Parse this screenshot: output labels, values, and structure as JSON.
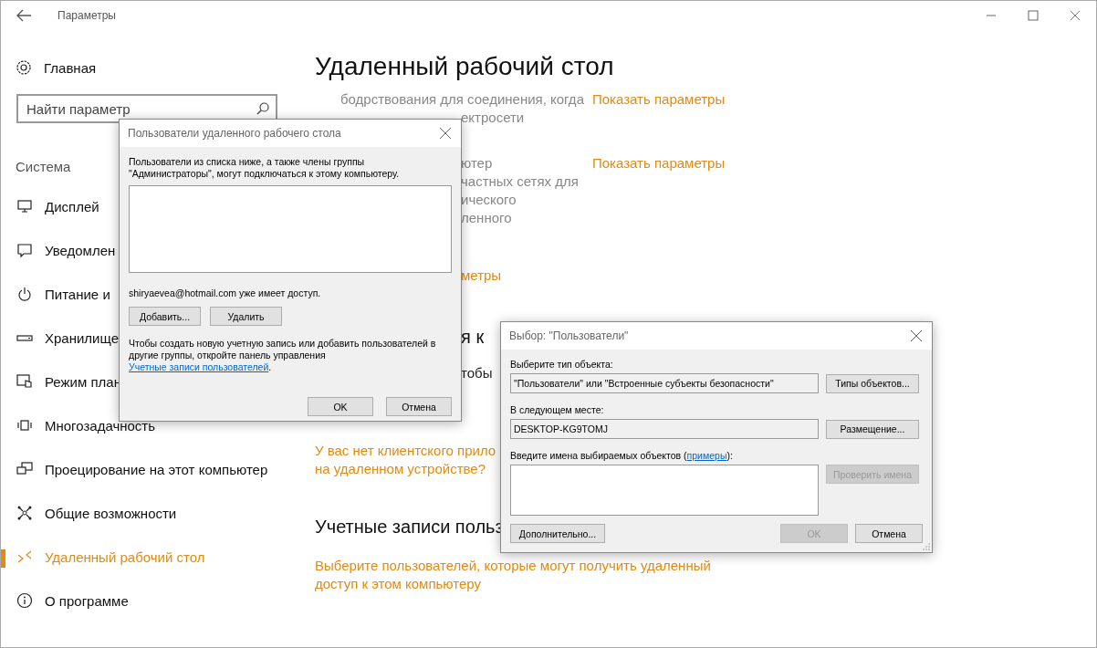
{
  "window": {
    "title": "Параметры"
  },
  "sidebar": {
    "home": "Главная",
    "search": {
      "placeholder": "Найти параметр"
    },
    "section": "Система",
    "items": [
      {
        "label": "Дисплей",
        "kind": "display",
        "selected": false
      },
      {
        "label": "Уведомлен",
        "kind": "notification",
        "selected": false
      },
      {
        "label": "Питание и",
        "kind": "power",
        "selected": false
      },
      {
        "label": "Хранилище",
        "kind": "storage",
        "selected": false
      },
      {
        "label": "Режим план",
        "kind": "tablet",
        "selected": false
      },
      {
        "label": "Многозадачность",
        "kind": "multitask",
        "selected": false
      },
      {
        "label": "Проецирование на этот компьютер",
        "kind": "project",
        "selected": false
      },
      {
        "label": "Общие возможности",
        "kind": "ease",
        "selected": false
      },
      {
        "label": "Удаленный рабочий стол",
        "kind": "remote",
        "selected": true
      },
      {
        "label": "О программе",
        "kind": "info",
        "selected": false
      }
    ]
  },
  "content": {
    "title": "Удаленный рабочий стол",
    "blocks": [
      {
        "kind": "setting",
        "lines": [
          "бодрствования для соединения, когда",
          "ектросети"
        ],
        "link": "Показать параметры"
      },
      {
        "kind": "setting",
        "lines": [
          "ютер",
          "частных сетях для",
          "ического",
          "ленного"
        ],
        "link": "Показать параметры"
      },
      {
        "kind": "link",
        "lines": [
          "метры"
        ]
      },
      {
        "kind": "heading",
        "lines": [
          "я к"
        ]
      },
      {
        "kind": "text",
        "lines": [
          "тобы"
        ]
      },
      {
        "kind": "link",
        "lines": [
          "У вас нет клиентского прило",
          "на удаленном устройстве?"
        ]
      },
      {
        "kind": "heading",
        "lines": [
          "Учетные записи польз"
        ]
      },
      {
        "kind": "link",
        "lines": [
          "Выберите пользователей, которые могут получить удаленный",
          "доступ к этом компьютеру"
        ]
      }
    ]
  },
  "users_dialog": {
    "title": "Пользователи удаленного рабочего стола",
    "intro": "Пользователи из списка ниже, а также члены группы \"Администраторы\", могут подключаться к этому компьютеру.",
    "status": "shiryaevea@hotmail.com уже имеет доступ.",
    "list_buttons": [
      {
        "label": "Добавить...",
        "disabled": false
      },
      {
        "label": "Удалить",
        "disabled": false
      }
    ],
    "help": {
      "text": "Чтобы создать новую учетную запись или добавить пользователей в другие группы, откройте панель управления",
      "link": "Учетные записи пользователей",
      "after": "."
    },
    "buttons": [
      {
        "label": "OK",
        "disabled": false
      },
      {
        "label": "Отмена",
        "disabled": false
      }
    ]
  },
  "select_dialog": {
    "title": "Выбор: \"Пользователи\"",
    "type_label": "Выберите тип объекта:",
    "type_value": "\"Пользователи\" или \"Встроенные субъекты безопасности\"",
    "type_button": {
      "label": "Типы объектов...",
      "disabled": false
    },
    "location_label": "В следующем месте:",
    "location_value": "DESKTOP-KG9TOMJ",
    "location_button": {
      "label": "Размещение...",
      "disabled": false
    },
    "names_label": "Введите имена выбираемых объектов (",
    "names_link": "примеры",
    "names_after": "):",
    "check_button": {
      "label": "Проверить имена",
      "disabled": true
    },
    "buttons": [
      {
        "label": "Дополнительно...",
        "disabled": false
      },
      {
        "label": "OK",
        "disabled": true
      },
      {
        "label": "Отмена",
        "disabled": false
      }
    ]
  }
}
